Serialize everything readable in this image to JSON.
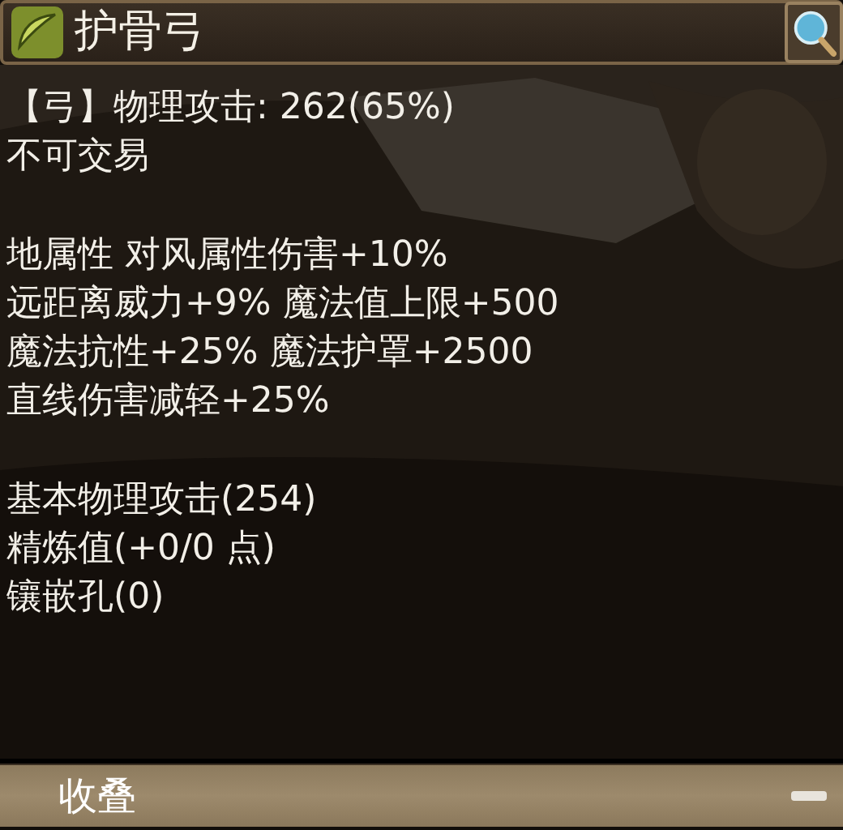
{
  "title": "护骨弓",
  "sections": [
    [
      "【弓】物理攻击: 262(65%)",
      "不可交易"
    ],
    [
      "地属性 对风属性伤害+10%",
      "远距离威力+9% 魔法值上限+500",
      "魔法抗性+25% 魔法护罩+2500",
      "直线伤害减轻+25%"
    ],
    [
      "基本物理攻击(254)",
      "精炼值(+0/0 点)",
      "镶嵌孔(0)"
    ]
  ],
  "footer": {
    "label": "收叠"
  }
}
